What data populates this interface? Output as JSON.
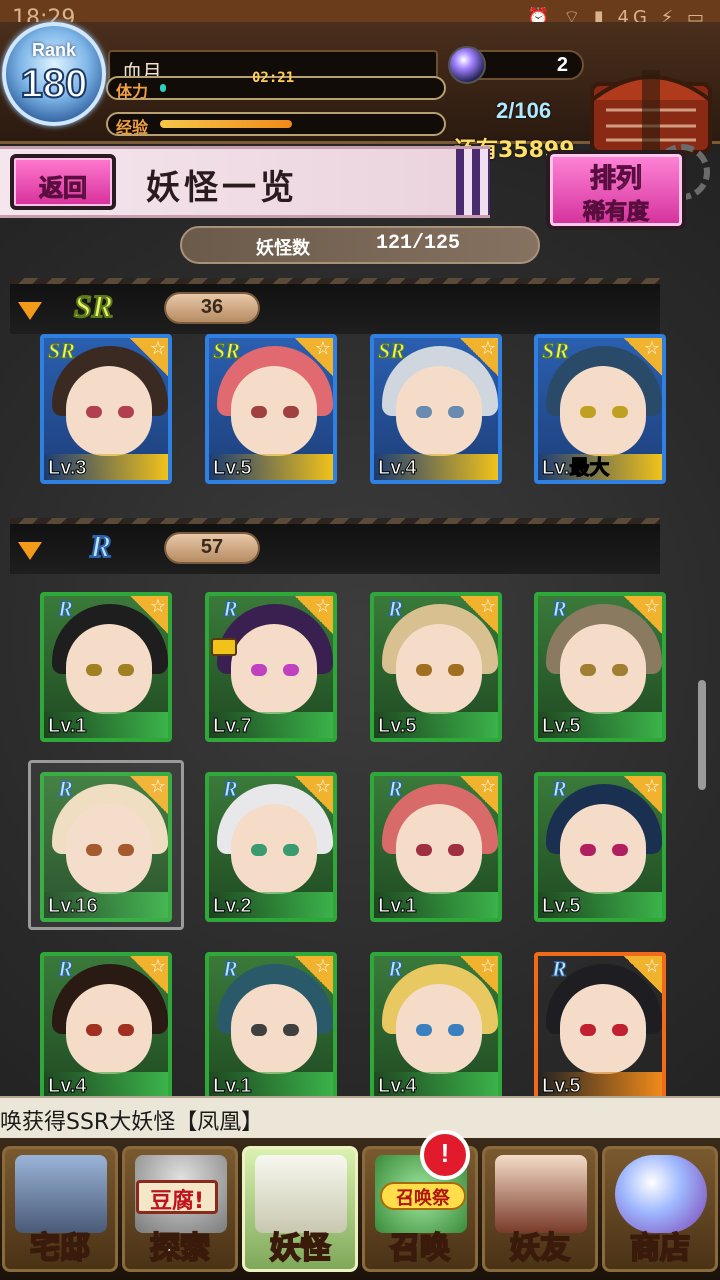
{
  "status_bar": {
    "time": "18:29",
    "icons": "⏰ ⌔ ▮ 4G ⚡ ▭"
  },
  "player": {
    "rank_label": "Rank",
    "rank": "180",
    "name": "血月",
    "stamina_label": "体力",
    "stamina_timer": "02:21",
    "stamina_level": 0.02,
    "exp_label": "经验",
    "exp_level": 0.47,
    "orbs": "2",
    "capacity": "2/106",
    "remaining": "还有35899"
  },
  "nav_top": {
    "back_label": "返回",
    "page_title": "妖怪一览",
    "sort_label_1": "排列",
    "sort_label_2": "稀有度"
  },
  "count": {
    "label": "妖怪数",
    "value": "121/125"
  },
  "groups": [
    {
      "rarity": "SR",
      "count": "36",
      "cards": [
        {
          "rarity": "SR",
          "level": "Lv.3",
          "frame": "blue"
        },
        {
          "rarity": "SR",
          "level": "Lv.5",
          "frame": "blue"
        },
        {
          "rarity": "SR",
          "level": "Lv.4",
          "frame": "blue"
        },
        {
          "rarity": "SR",
          "level": "Lv.最大",
          "frame": "blue"
        }
      ]
    },
    {
      "rarity": "R",
      "count": "57",
      "cards": [
        {
          "rarity": "R",
          "level": "Lv.1",
          "frame": "green"
        },
        {
          "rarity": "R",
          "level": "Lv.7",
          "frame": "green",
          "locked": true
        },
        {
          "rarity": "R",
          "level": "Lv.5",
          "frame": "green"
        },
        {
          "rarity": "R",
          "level": "Lv.5",
          "frame": "green"
        },
        {
          "rarity": "R",
          "level": "Lv.16",
          "frame": "green",
          "selected": true
        },
        {
          "rarity": "R",
          "level": "Lv.2",
          "frame": "green"
        },
        {
          "rarity": "R",
          "level": "Lv.1",
          "frame": "green"
        },
        {
          "rarity": "R",
          "level": "Lv.5",
          "frame": "green"
        },
        {
          "rarity": "R",
          "level": "Lv.4",
          "frame": "green"
        },
        {
          "rarity": "R",
          "level": "Lv.1",
          "frame": "green"
        },
        {
          "rarity": "R",
          "level": "Lv.4",
          "frame": "green"
        },
        {
          "rarity": "R",
          "level": "Lv.5",
          "frame": "orange"
        }
      ]
    }
  ],
  "ticker": "唤获得SSR大妖怪【凤凰】",
  "bottom_nav": {
    "home": "宅邸",
    "explore": "探索",
    "explore_sign": "豆腐!",
    "youkai": "妖怪",
    "summon": "召唤",
    "summon_tag": "召唤祭",
    "summon_alert": "!",
    "friends": "妖友",
    "shop": "商店"
  },
  "colors": {
    "sr_frame": "#2f80e0",
    "r_frame": "#2fa83a",
    "accent_pink": "#d72f9a",
    "exp_fill": "#f0a020",
    "stamina_fill": "#2fd0c0"
  }
}
